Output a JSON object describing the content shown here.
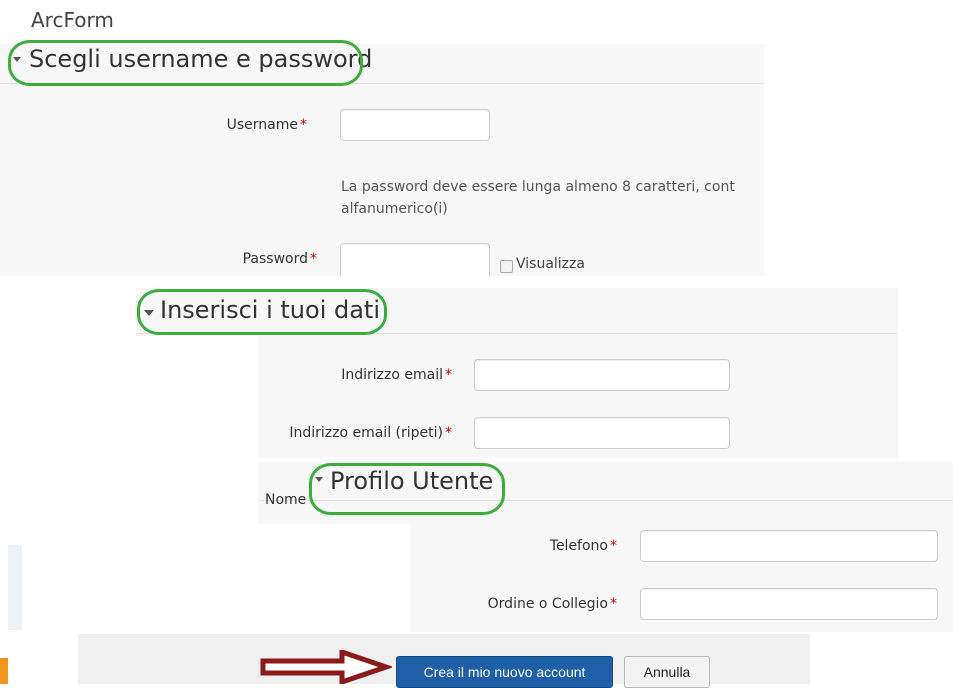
{
  "site_title": "ArcForm",
  "sections": {
    "credentials": {
      "title": "Scegli username e password",
      "username_label": "Username",
      "password_hint_line1": "La password deve essere lunga almeno 8 caratteri, cont",
      "password_hint_line2": "alfanumerico(i)",
      "password_label": "Password",
      "show_password_label": "Visualizza"
    },
    "personal": {
      "title": "Inserisci i tuoi dati",
      "email_label": "Indirizzo email",
      "email_repeat_label": "Indirizzo email (ripeti)",
      "name_label_partial": "Nome"
    },
    "profile": {
      "title": "Profilo Utente",
      "phone_label": "Telefono",
      "order_label": "Ordine o Collegio"
    }
  },
  "required_marker": "*",
  "actions": {
    "submit_label": "Crea il mio nuovo account",
    "cancel_label": "Annulla"
  },
  "colors": {
    "highlight_oval": "#3cae3c",
    "arrow": "#8b1a1a",
    "primary_button": "#1e5fa8",
    "required": "#cc0000"
  }
}
